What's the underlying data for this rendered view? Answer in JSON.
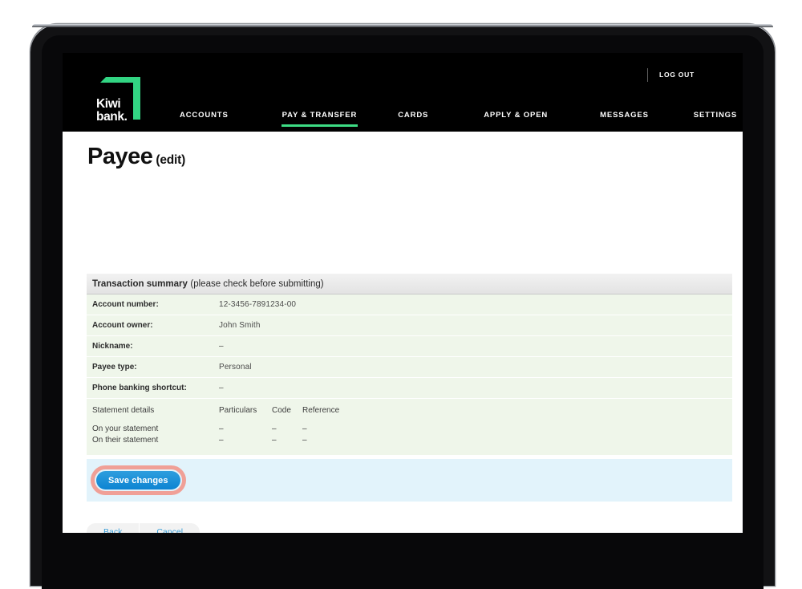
{
  "browser_chrome": {
    "device": "tablet"
  },
  "header": {
    "logout_label": "LOG OUT",
    "logo_text": "Kiwi\nbank.",
    "logo_green": "#32d583",
    "nav": [
      {
        "label": "ACCOUNTS",
        "active": false
      },
      {
        "label": "PAY & TRANSFER",
        "active": true
      },
      {
        "label": "CARDS",
        "active": false
      },
      {
        "label": "APPLY & OPEN",
        "active": false
      },
      {
        "label": "MESSAGES",
        "active": false
      },
      {
        "label": "SETTINGS",
        "active": false
      }
    ],
    "active_accent": "#3ddc84"
  },
  "page": {
    "title_main": "Payee",
    "title_sub": "(edit)"
  },
  "summary": {
    "header_strong": "Transaction summary",
    "header_note": "(please check before submitting)",
    "rows": [
      {
        "label": "Account number:",
        "value": "12-3456-7891234-00"
      },
      {
        "label": "Account owner:",
        "value": "John Smith"
      },
      {
        "label": "Nickname:",
        "value": "–"
      },
      {
        "label": "Payee type:",
        "value": "Personal"
      },
      {
        "label": "Phone banking shortcut:",
        "value": "–"
      }
    ],
    "statement": {
      "heading": "Statement details",
      "columns": [
        "Particulars",
        "Code",
        "Reference"
      ],
      "lines": [
        {
          "label": "On your statement",
          "particulars": "–",
          "code": "–",
          "reference": "–"
        },
        {
          "label": "On their statement",
          "particulars": "–",
          "code": "–",
          "reference": "–"
        }
      ]
    }
  },
  "actions": {
    "save_label": "Save changes",
    "save_bar_color": "#e2f3fb",
    "save_button_color": "#0d84d2",
    "highlight_ring_color": "#f0a097",
    "back_label": "Back",
    "cancel_label": "Cancel",
    "link_color": "#3b9fd8"
  }
}
